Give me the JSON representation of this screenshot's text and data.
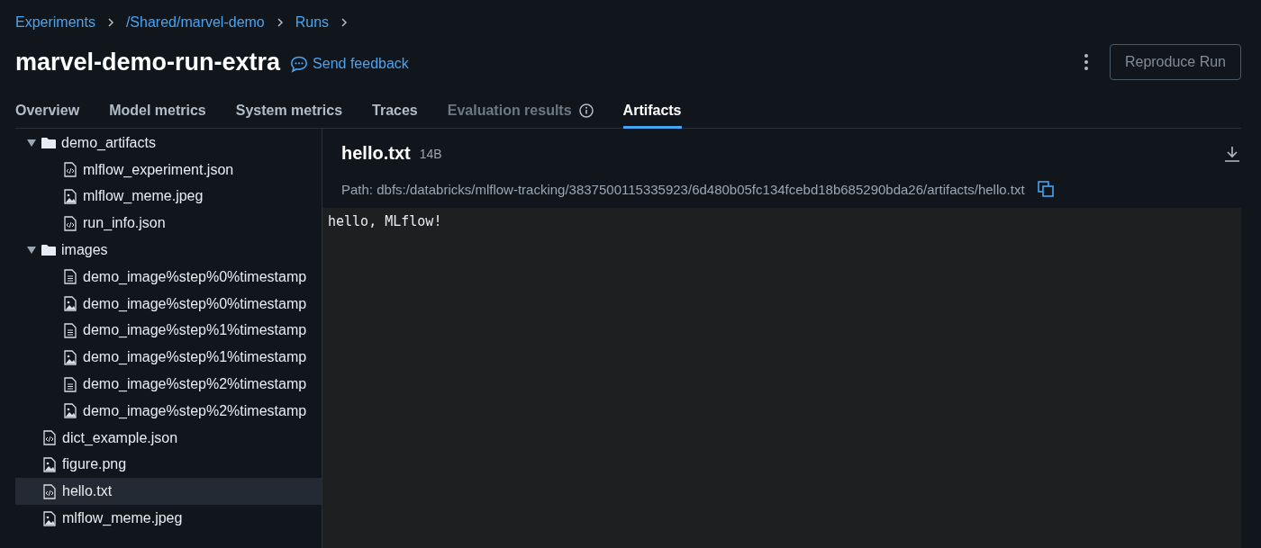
{
  "breadcrumbs": [
    "Experiments",
    "/Shared/marvel-demo",
    "Runs"
  ],
  "title": "marvel-demo-run-extra",
  "feedback": "Send feedback",
  "reproduce_button": "Reproduce Run",
  "tabs": [
    {
      "label": "Overview",
      "selected": false,
      "disabled": false,
      "info": false
    },
    {
      "label": "Model metrics",
      "selected": false,
      "disabled": false,
      "info": false
    },
    {
      "label": "System metrics",
      "selected": false,
      "disabled": false,
      "info": false
    },
    {
      "label": "Traces",
      "selected": false,
      "disabled": false,
      "info": false
    },
    {
      "label": "Evaluation results",
      "selected": false,
      "disabled": true,
      "info": true
    },
    {
      "label": "Artifacts",
      "selected": true,
      "disabled": false,
      "info": false
    }
  ],
  "tree": [
    {
      "kind": "folder",
      "name": "demo_artifacts",
      "expanded": true,
      "selected": false,
      "children": [
        {
          "kind": "code",
          "name": "mlflow_experiment.json",
          "selected": false
        },
        {
          "kind": "image",
          "name": "mlflow_meme.jpeg",
          "selected": false
        },
        {
          "kind": "code",
          "name": "run_info.json",
          "selected": false
        }
      ]
    },
    {
      "kind": "folder",
      "name": "images",
      "expanded": true,
      "selected": false,
      "children": [
        {
          "kind": "text",
          "name": "demo_image%step%0%timestamp",
          "selected": false
        },
        {
          "kind": "image",
          "name": "demo_image%step%0%timestamp",
          "selected": false
        },
        {
          "kind": "text",
          "name": "demo_image%step%1%timestamp",
          "selected": false
        },
        {
          "kind": "image",
          "name": "demo_image%step%1%timestamp",
          "selected": false
        },
        {
          "kind": "text",
          "name": "demo_image%step%2%timestamp",
          "selected": false
        },
        {
          "kind": "image",
          "name": "demo_image%step%2%timestamp",
          "selected": false
        }
      ]
    },
    {
      "kind": "code",
      "name": "dict_example.json",
      "selected": false
    },
    {
      "kind": "image",
      "name": "figure.png",
      "selected": false
    },
    {
      "kind": "code",
      "name": "hello.txt",
      "selected": true
    },
    {
      "kind": "image",
      "name": "mlflow_meme.jpeg",
      "selected": false
    }
  ],
  "preview": {
    "name": "hello.txt",
    "size": "14B",
    "path": "Path: dbfs:/databricks/mlflow-tracking/3837500115335923/6d480b05fc134fcebd18b685290bda26/artifacts/hello.txt",
    "content": "hello, MLflow!"
  }
}
